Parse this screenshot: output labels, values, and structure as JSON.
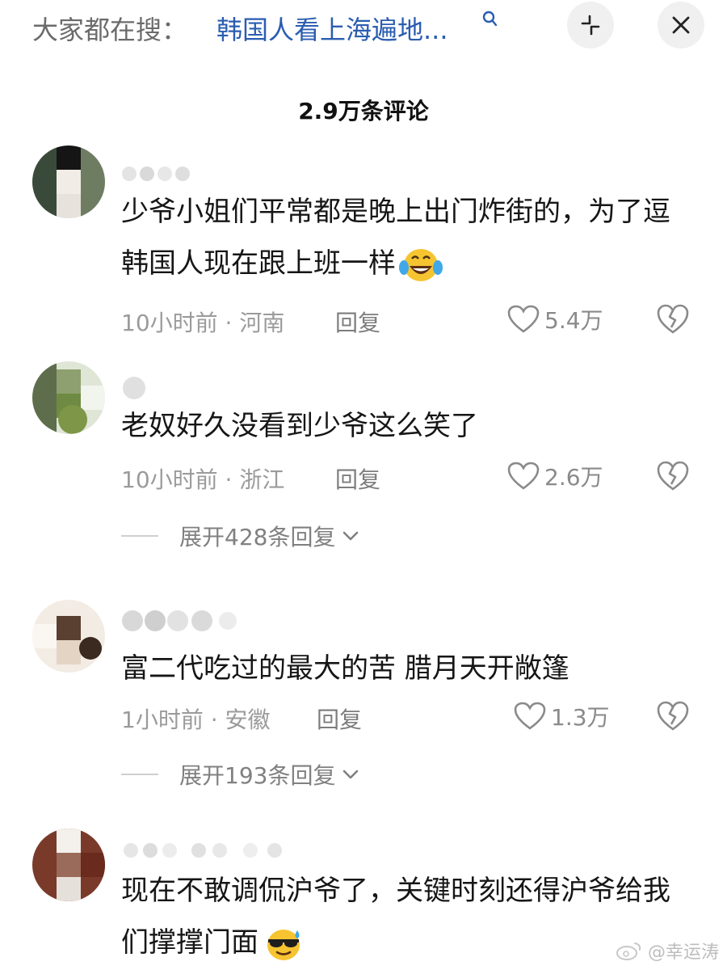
{
  "search": {
    "prefix": "大家都在搜：",
    "query": "韩国人看上海遍地..."
  },
  "header": {
    "comment_count": "2.9万条评论"
  },
  "icons": {
    "search": "search-icon",
    "compress": "compress-icon",
    "close": "close-icon",
    "like": "heart-outline-icon",
    "dislike": "broken-heart-icon",
    "expand": "chevron-down-icon",
    "emoji_laugh": "tears-of-joy-emoji",
    "emoji_cool": "sunglasses-sweat-emoji"
  },
  "colors": {
    "query_blue": "#2a5db0",
    "meta_gray": "#9b9b9b",
    "text": "#161616"
  },
  "comments": [
    {
      "text": "少爷小姐们平常都是晚上出门炸街的，为了逗韩国人现在跟上班一样",
      "time": "10小时前",
      "location": "河南",
      "reply_label": "回复",
      "likes": "5.4万"
    },
    {
      "text": "老奴好久没看到少爷这么笑了",
      "time": "10小时前",
      "location": "浙江",
      "reply_label": "回复",
      "likes": "2.6万",
      "expand_label": "展开428条回复"
    },
    {
      "text": "富二代吃过的最大的苦 腊月天开敞篷",
      "time": "1小时前",
      "location": "安徽",
      "reply_label": "回复",
      "likes": "1.3万",
      "expand_label": "展开193条回复"
    },
    {
      "text": "现在不敢调侃沪爷了，关键时刻还得沪爷给我们撑撑门面"
    }
  ],
  "watermark": {
    "text": "@幸运涛"
  }
}
